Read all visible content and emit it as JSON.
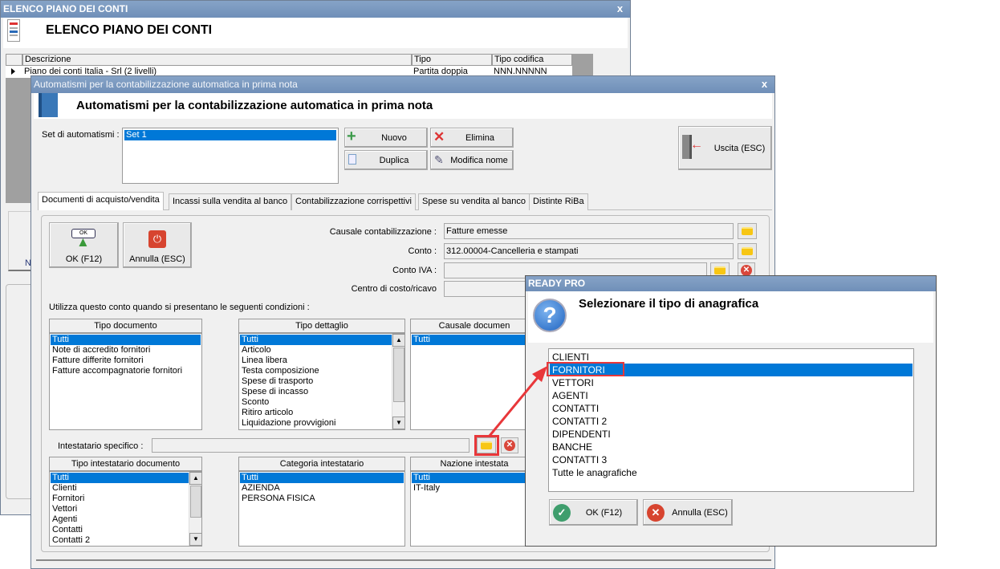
{
  "back_window": {
    "title": "ELENCO PIANO DEI CONTI",
    "heading": "ELENCO PIANO DEI CONTI",
    "close": "x",
    "columns": [
      "Descrizione",
      "Tipo",
      "Tipo codifica"
    ],
    "rows": [
      {
        "descrizione": "Piano dei conti Italia - Srl (2 livelli)",
        "tipo": "Partita doppia",
        "codifica": "NNN.NNNNN"
      }
    ],
    "partial_label": "N"
  },
  "main_window": {
    "title": "Automatismi per la contabilizzazione automatica in prima nota",
    "heading": "Automatismi per la contabilizzazione automatica in prima nota",
    "close": "x",
    "set_label": "Set di automatismi :",
    "sets": [
      "Set 1"
    ],
    "buttons": {
      "nuovo": "Nuovo",
      "elimina": "Elimina",
      "duplica": "Duplica",
      "modifica": "Modifica nome",
      "uscita": "Uscita (ESC)",
      "ok": "OK (F12)",
      "annulla": "Annulla (ESC)",
      "ok_icon_text": "OK"
    },
    "tabs": [
      "Documenti di acquisto/vendita",
      "Incassi sulla vendita al banco",
      "Contabilizzazione corrispettivi",
      "Spese su vendita al banco",
      "Distinte RiBa"
    ],
    "fields": {
      "causale_label": "Causale contabilizzazione :",
      "causale_value": "Fatture emesse",
      "conto_label": "Conto :",
      "conto_value": "312.00004-Cancelleria e stampati",
      "iva_label": "Conto IVA :",
      "iva_value": "",
      "centro_label": "Centro di costo/ricavo",
      "centro_value": ""
    },
    "conditions_label": "Utilizza questo conto quando si presentano le seguenti condizioni :",
    "tipo_documento": {
      "header": "Tipo documento",
      "items": [
        "Tutti",
        "Note di accredito fornitori",
        "Fatture differite fornitori",
        "Fatture accompagnatorie fornitori"
      ]
    },
    "tipo_dettaglio": {
      "header": "Tipo dettaglio",
      "items": [
        "Tutti",
        "Articolo",
        "Linea libera",
        "Testa composizione",
        "Spese di trasporto",
        "Spese di incasso",
        "Sconto",
        "Ritiro articolo",
        "Liquidazione provvigioni"
      ]
    },
    "causale_documento": {
      "header": "Causale documen",
      "items": [
        "Tutti"
      ]
    },
    "intestatario_label": "Intestatario specifico :",
    "intestatario_value": "",
    "tipo_intestatario": {
      "header": "Tipo intestatario documento",
      "items": [
        "Tutti",
        "Clienti",
        "Fornitori",
        "Vettori",
        "Agenti",
        "Contatti",
        "Contatti 2"
      ]
    },
    "categoria_intestatario": {
      "header": "Categoria intestatario",
      "items": [
        "Tutti",
        "AZIENDA",
        "PERSONA FISICA"
      ]
    },
    "nazione_intestatario": {
      "header": "Nazione intestata",
      "items": [
        "Tutti",
        "IT-Italy"
      ]
    }
  },
  "dialog": {
    "title": "READY PRO",
    "message": "Selezionare il tipo di anagrafica",
    "items": [
      "CLIENTI",
      "FORNITORI",
      "VETTORI",
      "AGENTI",
      "CONTATTI",
      "CONTATTI 2",
      "DIPENDENTI",
      "BANCHE",
      "CONTATTI 3",
      "Tutte le anagrafiche"
    ],
    "selected_index": 1,
    "ok": "OK (F12)",
    "annulla": "Annulla (ESC)"
  },
  "colors": {
    "selection": "#0078d7",
    "titlebar": "#7a98c0",
    "highlight": "#e8373a"
  }
}
